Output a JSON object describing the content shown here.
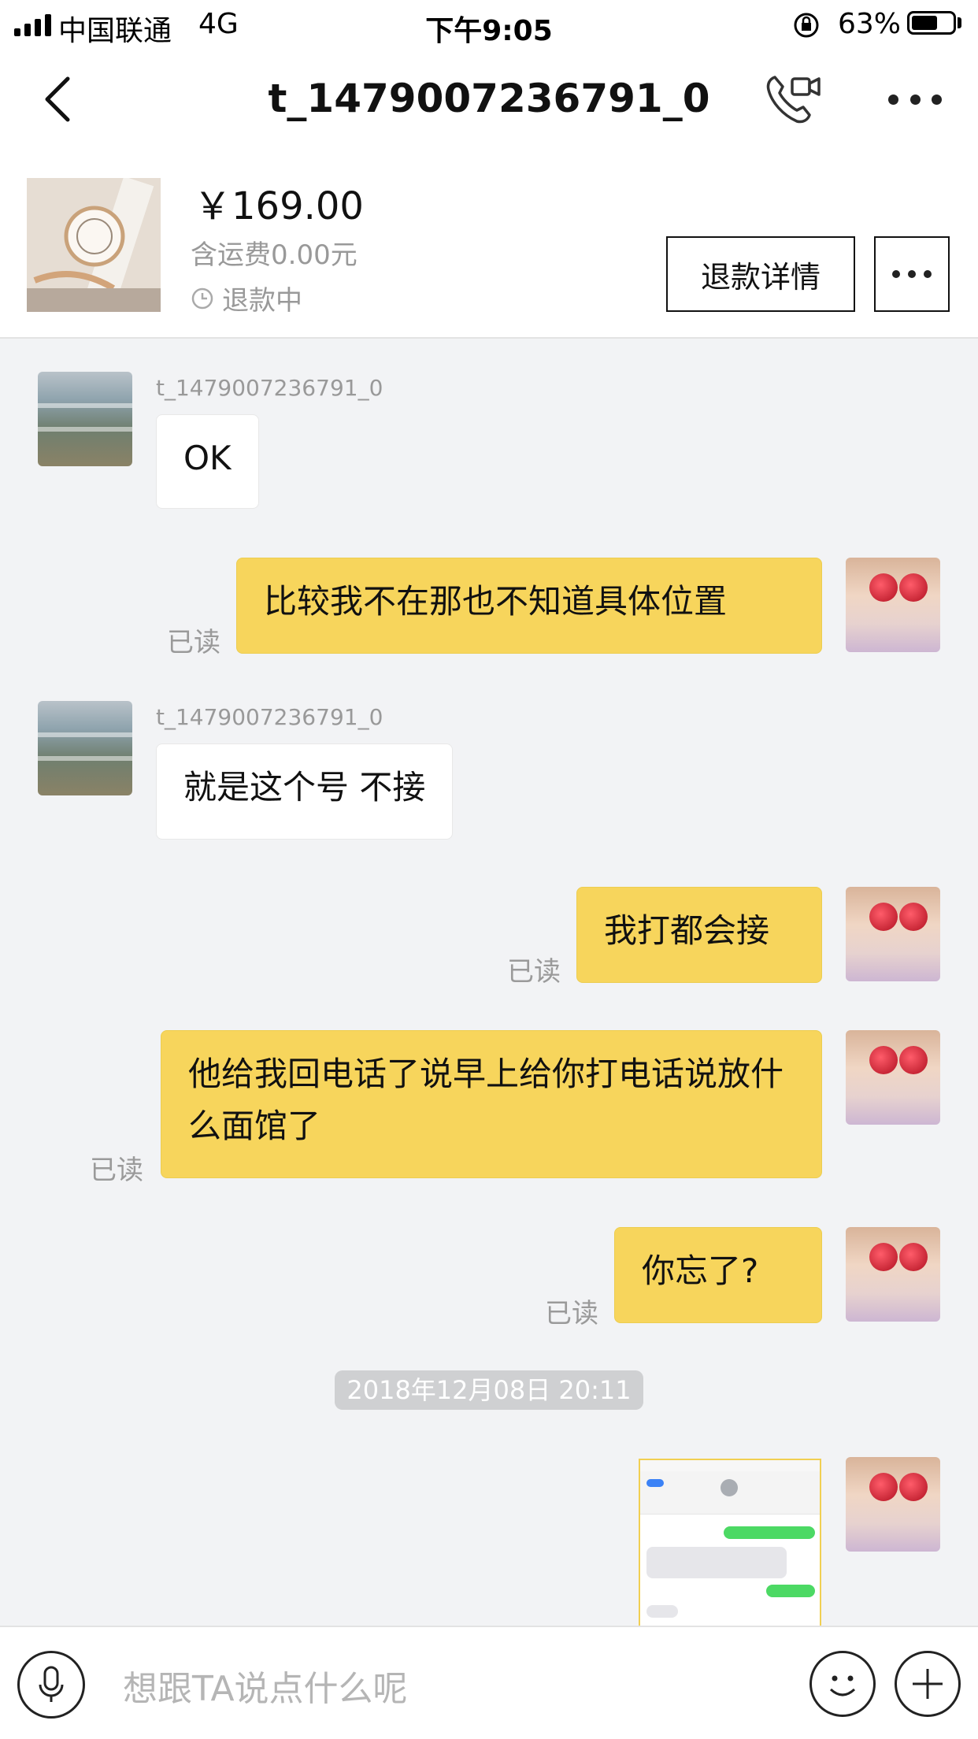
{
  "status_bar": {
    "carrier": "中国联通",
    "network": "4G",
    "time": "下午9:05",
    "battery_percent": "63%",
    "battery_level": 0.63
  },
  "nav": {
    "title": "t_1479007236791_0",
    "icons": [
      "back-arrow-icon",
      "video-call-icon",
      "more-icon"
    ]
  },
  "order": {
    "price": "￥169.00",
    "shipping": "含运费0.00元",
    "status": "退款中",
    "refund_button": "退款详情"
  },
  "messages": [
    {
      "side": "in",
      "sender": "t_1479007236791_0",
      "text": "OK"
    },
    {
      "side": "out",
      "text": "比较我不在那也不知道具体位置",
      "read": "已读"
    },
    {
      "side": "in",
      "sender": "t_1479007236791_0",
      "text": "就是这个号 不接"
    },
    {
      "side": "out",
      "text": "我打都会接",
      "read": "已读"
    },
    {
      "side": "out",
      "text": "他给我回电话了说早上给你打电话说放什么面馆了",
      "read": "已读"
    },
    {
      "side": "out",
      "text": "你忘了?",
      "read": "已读"
    },
    {
      "side": "out",
      "type": "image",
      "text": ""
    }
  ],
  "timestamp": "2018年12月08日 20:11",
  "input": {
    "placeholder": "想跟TA说点什么呢",
    "icons": [
      "microphone-icon",
      "emoji-icon",
      "plus-icon"
    ]
  }
}
